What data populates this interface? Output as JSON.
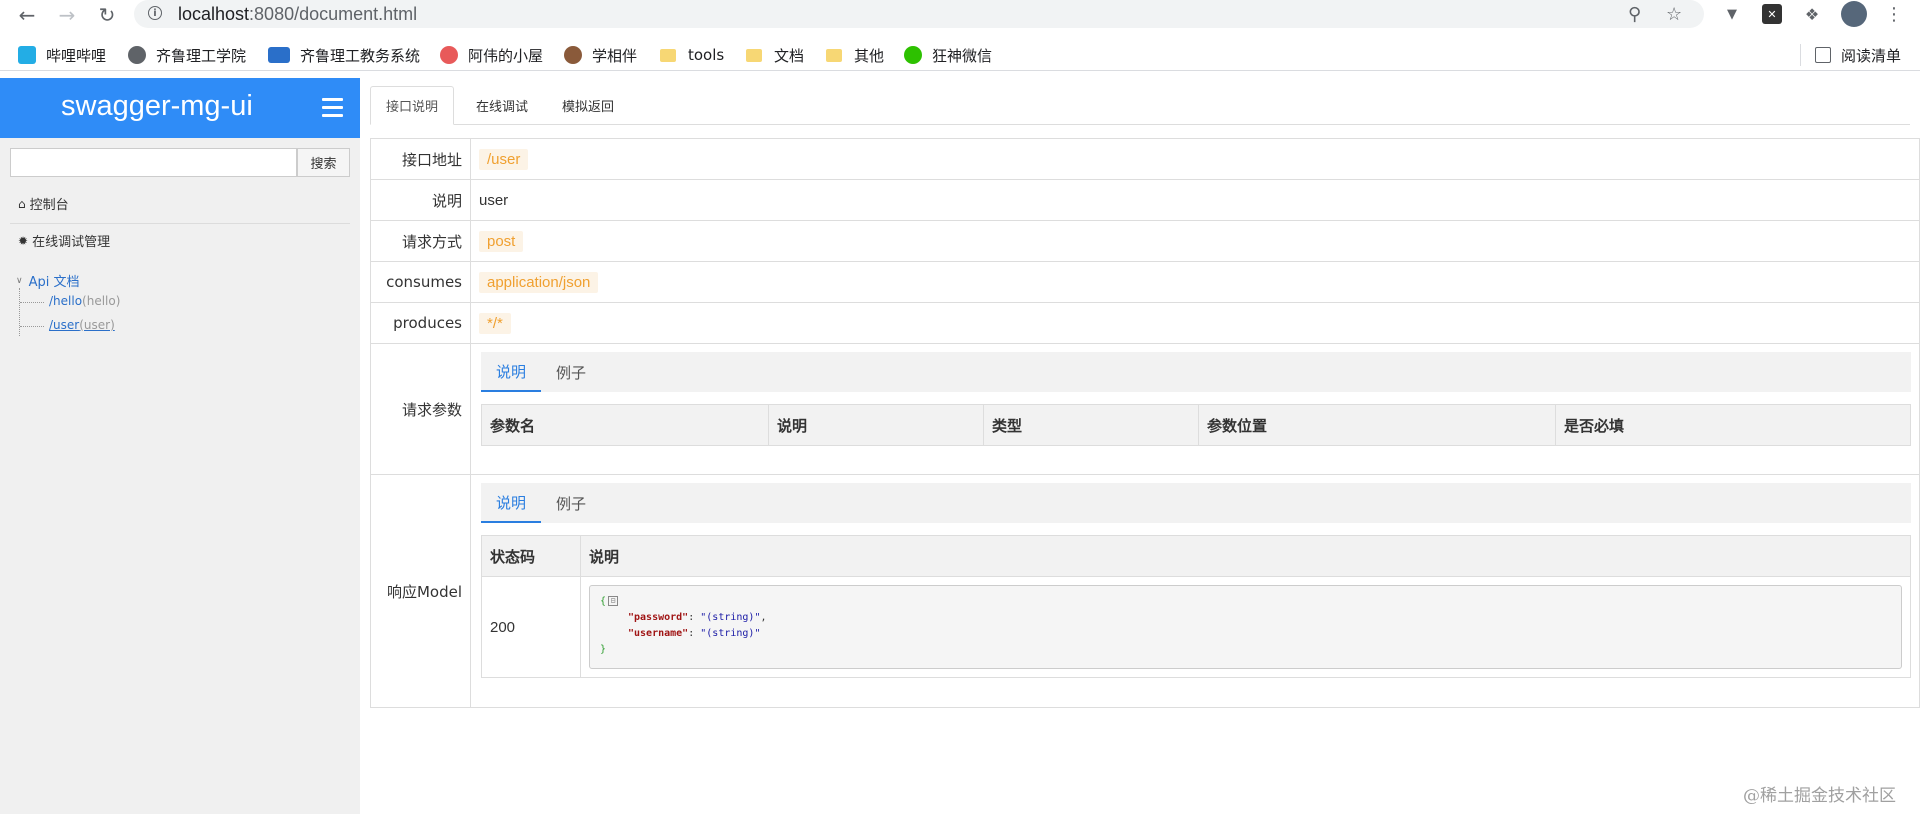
{
  "browser": {
    "url_host": "localhost",
    "url_path": ":8080/document.html",
    "bookmarks": [
      {
        "label": "哔哩哔哩",
        "icon": "bilibili-icon",
        "color": "#23ade5"
      },
      {
        "label": "齐鲁理工学院",
        "icon": "globe-icon",
        "color": "#5f6368"
      },
      {
        "label": "齐鲁理工教务系统",
        "icon": "urp-icon",
        "color": "#2a6fc9"
      },
      {
        "label": "阿伟的小屋",
        "icon": "peach-icon",
        "color": "#e85a5a"
      },
      {
        "label": "学相伴",
        "icon": "avatar-icon",
        "color": "#8a5a3a"
      },
      {
        "label": "tools",
        "icon": "folder-icon",
        "color": "#f7d774"
      },
      {
        "label": "文档",
        "icon": "folder-icon",
        "color": "#f7d774"
      },
      {
        "label": "其他",
        "icon": "folder-icon",
        "color": "#f7d774"
      },
      {
        "label": "狂神微信",
        "icon": "wechat-icon",
        "color": "#2dc100"
      }
    ],
    "reading_list": "阅读清单"
  },
  "sidebar": {
    "title": "swagger-mg-ui",
    "search_button": "搜索",
    "search_placeholder": "",
    "menu": [
      {
        "label": "控制台",
        "icon": "home-icon"
      },
      {
        "label": "在线调试管理",
        "icon": "bug-icon"
      }
    ],
    "tree": {
      "root": "Api 文档",
      "children": [
        {
          "path": "/hello",
          "name": "(hello)"
        },
        {
          "path": "/user",
          "name": "(user)"
        }
      ]
    }
  },
  "main": {
    "tabs": [
      "接口说明",
      "在线调试",
      "模拟返回"
    ],
    "fields": {
      "address_label": "接口地址",
      "address_value": "/user",
      "desc_label": "说明",
      "desc_value": "user",
      "method_label": "请求方式",
      "method_value": "post",
      "consumes_label": "consumes",
      "consumes_value": "application/json",
      "produces_label": "produces",
      "produces_value": "*/*"
    },
    "request": {
      "label": "请求参数",
      "subtabs": [
        "说明",
        "例子"
      ],
      "columns": [
        "参数名",
        "说明",
        "类型",
        "参数位置",
        "是否必填"
      ]
    },
    "response": {
      "label": "响应Model",
      "subtabs": [
        "说明",
        "例子"
      ],
      "columns": [
        "状态码",
        "说明"
      ],
      "rows": [
        {
          "code": "200",
          "json_open": "{",
          "json_collapse": "⊟",
          "entries": [
            {
              "key": "\"password\"",
              "value": "\"(string)\"",
              "sep": ","
            },
            {
              "key": "\"username\"",
              "value": "\"(string)\"",
              "sep": ""
            }
          ],
          "json_close": "}"
        }
      ]
    }
  },
  "watermark": "@稀土掘金技术社区"
}
